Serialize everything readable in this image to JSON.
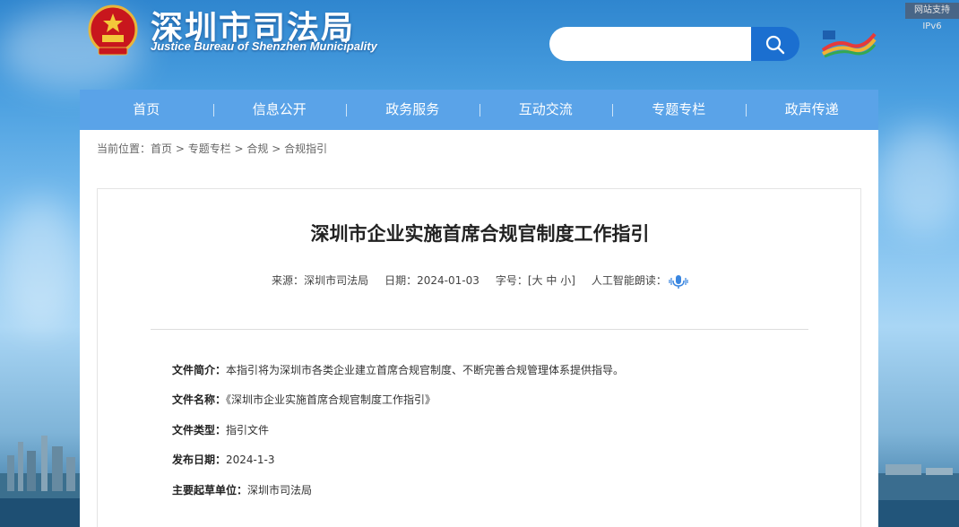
{
  "header": {
    "title": "深圳市司法局",
    "subtitle": "Justice Bureau of Shenzhen Municipality",
    "ipv6": "网站支持IPv6",
    "search_placeholder": ""
  },
  "nav": {
    "items": [
      "首页",
      "信息公开",
      "政务服务",
      "互动交流",
      "专题专栏",
      "政声传递"
    ]
  },
  "breadcrumb": {
    "prefix": "当前位置：",
    "items": [
      "首页",
      "专题专栏",
      "合规",
      "合规指引"
    ],
    "separator": " > "
  },
  "article": {
    "title": "深圳市企业实施首席合规官制度工作指引",
    "source_label": "来源：",
    "source": "深圳市司法局",
    "date_label": "日期：",
    "date": "2024-01-03",
    "font_label": "字号：[",
    "font_large": "大",
    "font_medium": "中",
    "font_small": "小",
    "font_close": "]",
    "ai_read_label": "人工智能朗读："
  },
  "info": {
    "summary_label": "文件简介：",
    "summary": "本指引将为深圳市各类企业建立首席合规官制度、不断完善合规管理体系提供指导。",
    "name_label": "文件名称：",
    "name": "《深圳市企业实施首席合规官制度工作指引》",
    "type_label": "文件类型：",
    "type": "指引文件",
    "pubdate_label": "发布日期：",
    "pubdate": "2024-1-3",
    "drafter_label": "主要起草单位：",
    "drafter": "深圳市司法局"
  },
  "colors": {
    "nav": "#5aa3e8",
    "search_button": "#1b6fd0",
    "title_text": "#ffffff"
  }
}
